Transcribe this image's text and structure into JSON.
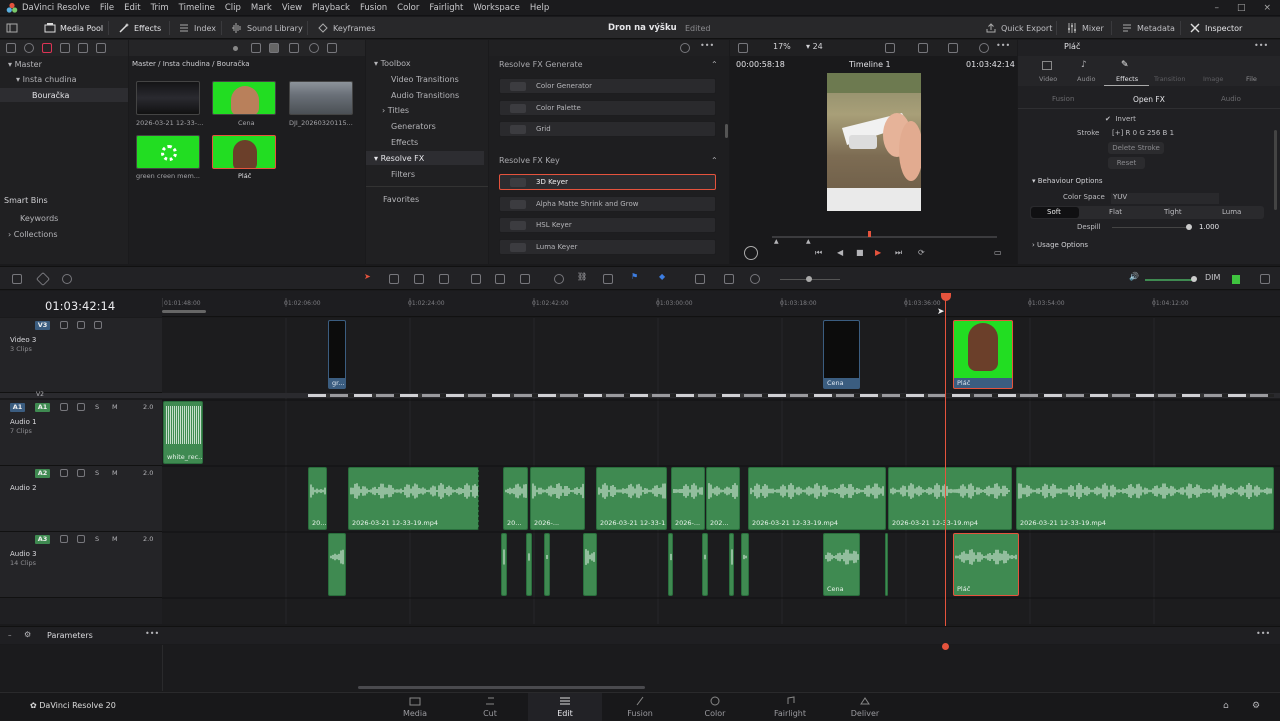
{
  "app": {
    "menu": [
      "DaVinci Resolve",
      "File",
      "Edit",
      "Trim",
      "Timeline",
      "Clip",
      "Mark",
      "View",
      "Playback",
      "Fusion",
      "Color",
      "Fairlight",
      "Workspace",
      "Help"
    ],
    "window_controls": [
      "–",
      "□",
      "×"
    ],
    "brand_color": "#e5533d"
  },
  "toolbar": {
    "media_pool": "Media Pool",
    "effects": "Effects",
    "index": "Index",
    "sound_library": "Sound Library",
    "keyframes": "Keyframes",
    "project_name": "Dron na výšku",
    "project_status": "Edited",
    "quick_export": "Quick Export",
    "mixer": "Mixer",
    "metadata": "Metadata",
    "inspector": "Inspector"
  },
  "media_pool": {
    "tree": [
      "Master",
      "Insta chudina",
      "Bouračka"
    ],
    "smart_bins": "Smart Bins",
    "smart_items": [
      "Keywords",
      "Collections"
    ],
    "path": "Master / Insta chudina / Bouračka",
    "clips": [
      {
        "name": "2026-03-21 12-33-...",
        "kind": "dark"
      },
      {
        "name": "Cena",
        "kind": "green-face"
      },
      {
        "name": "DJI_20260320115...",
        "kind": "aerial"
      },
      {
        "name": "green creen mem...",
        "kind": "green-loader"
      },
      {
        "name": "Pláč",
        "kind": "green-face2"
      }
    ]
  },
  "effects": {
    "toolbox_title": "Toolbox",
    "items": [
      "Video Transitions",
      "Audio Transitions",
      "Titles",
      "Generators",
      "Effects"
    ],
    "active": "Resolve FX",
    "filters": "Filters",
    "favorites": "Favorites",
    "group1": {
      "title": "Resolve FX Generate",
      "items": [
        "Color Generator",
        "Color Palette",
        "Grid"
      ]
    },
    "group2": {
      "title": "Resolve FX Key",
      "items": [
        "3D Keyer",
        "Alpha Matte Shrink and Grow",
        "HSL Keyer",
        "Luma Keyer"
      ]
    },
    "selected": "3D Keyer"
  },
  "viewer": {
    "zoom": "17%",
    "fps": "24",
    "tc_left": "00:00:58:18",
    "timeline_name": "Timeline 1",
    "tc_right": "01:03:42:14"
  },
  "inspector": {
    "tabs": [
      "Video",
      "Audio",
      "Effects",
      "Transition",
      "Image",
      "File"
    ],
    "active_tab": "Effects",
    "subtabs": [
      "Fusion",
      "Open FX",
      "Audio"
    ],
    "active_subtab": "Open FX",
    "invert": "Invert",
    "stroke_label": "Stroke",
    "stroke_value": "[+]  R 0  G 256  B 1",
    "delete_stroke": "Delete Stroke",
    "reset": "Reset",
    "behaviour": "Behaviour Options",
    "color_space_label": "Color Space",
    "color_space": "YUV",
    "modes": [
      "Soft",
      "Flat",
      "Tight",
      "Luma"
    ],
    "active_mode": "Soft",
    "despill_label": "Despill",
    "despill_value": "1.000",
    "despill_level": 1.0,
    "usage": "Usage Options"
  },
  "timeline": {
    "timecode": "01:03:42:14",
    "ruler": [
      "01:01:48:00",
      "01:02:06:00",
      "01:02:24:00",
      "01:02:42:00",
      "01:03:00:00",
      "01:03:18:00",
      "01:03:36:00",
      "01:03:54:00",
      "01:04:12:00"
    ],
    "tracks": [
      {
        "id": "V3",
        "name": "Video 3",
        "count": "3 Clips",
        "badge_color": "#3b5d80"
      },
      {
        "id": "A1",
        "name": "Audio 1",
        "count": "7 Clips",
        "level": "2.0",
        "badge_color": "#3f8a51"
      },
      {
        "id": "A2",
        "name": "Audio 2",
        "count": "",
        "level": "2.0",
        "badge_color": "#3f8a51"
      },
      {
        "id": "A3",
        "name": "Audio 3",
        "count": "14 Clips",
        "level": "2.0",
        "badge_color": "#3f8a51"
      }
    ],
    "v2_label": "V2",
    "video_clips": [
      "gr...",
      "Cena",
      "Pláč"
    ],
    "a1_clip": "white_rec...",
    "a2_clips": [
      "20...",
      "2026-03-21 12-33-19.mp4",
      "20...",
      "2026-...",
      "2026-03-21 12-33-1...",
      "2026-...",
      "202...",
      "2026-03-21 12-33-19.mp4",
      "2026-03-21 12-33-19.mp4",
      "2026-03-21 12-33-19.mp4"
    ],
    "a3_clips": [
      "Cena",
      "Pláč"
    ],
    "master_level": "DIM",
    "params": "Parameters"
  },
  "pages": [
    "Media",
    "Cut",
    "Edit",
    "Fusion",
    "Color",
    "Fairlight",
    "Deliver"
  ],
  "active_page": "Edit",
  "version_label": "DaVinci Resolve 20"
}
